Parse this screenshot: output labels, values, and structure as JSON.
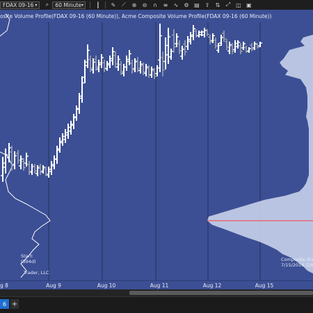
{
  "toolbar": {
    "instrument": "FDAX 09-16",
    "interval": "60 Minute",
    "icons": [
      "magnifier-icon",
      "clock-icon",
      "bar-type-icon",
      "pencil-icon",
      "drawing-icon",
      "zoom-in-icon",
      "zoom-out-icon",
      "magnet-icon",
      "properties-icon",
      "indicators-icon",
      "strategies-icon",
      "templates-icon",
      "share-icon",
      "chart-trader-icon",
      "fullscreen-icon",
      "split-icon",
      "data-box-icon"
    ]
  },
  "chart": {
    "title": "osite Volume Profile(FDAX 09-16 (60 Minute)), Acme Composite Volume Profile(FDAX 09-16 (60 Minute))",
    "left_note_1": "Start:",
    "left_note_2": "(394d)",
    "footer_left": "Trader, LLC",
    "composite_note_1": "Composite Star",
    "composite_note_2": "7/15/2016 (28d"
  },
  "x_axis": {
    "labels": [
      "g 8",
      "Aug 9",
      "Aug 10",
      "Aug 11",
      "Aug 12",
      "Aug 15"
    ]
  },
  "tabs": {
    "active_label": "6",
    "add_label": "+"
  },
  "colors": {
    "background": "#3c4f94",
    "up_bar": "#ffffff",
    "down_bar": "#9aa0aa",
    "profile": "#c7d0ea",
    "poc_line": "#ff3b3b",
    "separator": "#26305a"
  }
}
